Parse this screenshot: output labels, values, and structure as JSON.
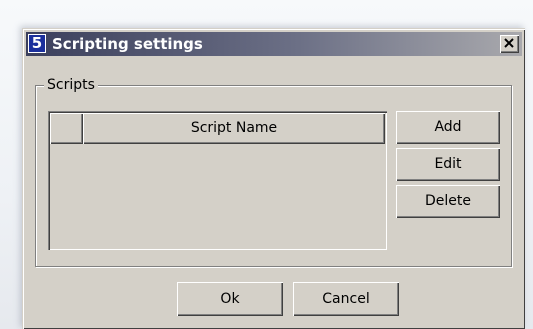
{
  "window": {
    "icon_glyph": "5",
    "title": "Scripting settings",
    "close_icon": "close-icon"
  },
  "scripts_group": {
    "label": "Scripts",
    "list": {
      "columns": [
        "",
        "Script Name"
      ],
      "rows": []
    },
    "buttons": {
      "add": "Add",
      "edit": "Edit",
      "delete": "Delete"
    }
  },
  "footer": {
    "ok": "Ok",
    "cancel": "Cancel"
  },
  "colors": {
    "face": "#d4d0c8",
    "title_dark": "#3b3f5c",
    "title_light": "#a9a9ad",
    "icon_bg": "#1b2f9c"
  }
}
